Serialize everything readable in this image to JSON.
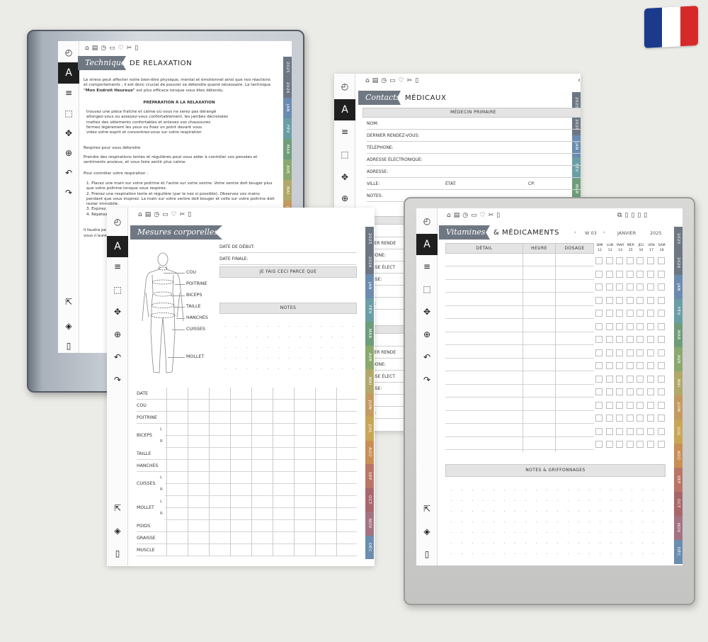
{
  "flag": {
    "colors": [
      "#1b3a8c",
      "#ffffff",
      "#d62a2a"
    ]
  },
  "toolbar_icons": [
    "timer-icon",
    "pen-icon",
    "menu-icon",
    "eraser-icon",
    "move-icon",
    "zoom-icon",
    "undo-icon",
    "redo-icon",
    "export-icon",
    "layers-icon",
    "sidebar-icon"
  ],
  "months": [
    "2025",
    "2026",
    "JAN",
    "FÉV",
    "MAR",
    "AVR",
    "MAI",
    "JUIN",
    "JUIL",
    "AOÛ",
    "SEP",
    "OCT",
    "NOV",
    "DÉC"
  ],
  "month_colors": [
    "#6d7783",
    "#6d7783",
    "#6b8bb0",
    "#6a9ea6",
    "#6f9d79",
    "#8aa96e",
    "#b1a86a",
    "#c49a61",
    "#c9a556",
    "#c98f55",
    "#b97565",
    "#a9676b",
    "#a57283",
    "#6a8db0"
  ],
  "relax": {
    "banner": "Techniques",
    "title": "DE RELAXATION",
    "intro": "Le stress peut affecter notre bien-être physique, mental et émotionnel ainsi que nos réactions et comportements ; il est donc crucial de pouvoir se détendre quand nécessaire. La technique",
    "intro_bold": "\"Mon Endroit Heureux\"",
    "intro_end": "est plus efficace lorsque vous êtes détendu.",
    "prep_title": "PRÉPARATION À LA RELAXATION",
    "bullets": [
      "trouvez une pièce fraîche et calme où vous ne serez pas dérangé",
      "allongez-vous ou asseyez-vous confortablement, les jambes décroisées",
      "mettez des vêtements confortables et enlevez vos chaussures",
      "fermez légèrement les yeux ou fixez un point devant vous",
      "videz votre esprit et concentrez-vous sur votre respiration"
    ],
    "breathe": "Respirez pour vous détendre",
    "breathe_text": "Prendre des respirations lentes et régulières peut vous aider à contrôler vos pensées et sentiments anxieux, et vous faire sentir plus calme.",
    "control": "Pour contrôler votre respiration :",
    "steps": [
      "1. Placez une main sur votre poitrine et l'autre sur votre ventre. Votre ventre doit bouger plus que votre poitrine lorsque vous respirez.",
      "2. Prenez une respiration lente et régulière (par le nez si possible). Observez vos mains pendant que vous inspirez. La main sur votre ventre doit bouger et celle sur votre poitrine doit rester immobile.",
      "3. Expirez a",
      "4. Répétez"
    ],
    "tail1": "Il faudra pe",
    "tail2": "vous n'aure"
  },
  "contacts": {
    "banner": "Contacts",
    "title": "MÉDICAUX",
    "section": "MÉDECIN PRIMAIRE",
    "fields": [
      "NOM:",
      "DERNIER RENDEZ-VOUS:",
      "TÉLÉPHONE:",
      "ADRESSE ÉLECTRONIQUE:",
      "ADRESSE:"
    ],
    "ville": "VILLE:",
    "etat": "ÉTAT:",
    "cp": "CP:",
    "notes": "NOTES:",
    "partial1": [
      "M:",
      "RNIER RENDE",
      "ÉPHONE:",
      "RESSE ÉLECT",
      "RESSE:",
      "LE:",
      "TES:"
    ],
    "partial2": [
      "M:",
      "RNIER RENDE",
      "ÉPHONE:",
      "RESSE ÉLECT",
      "RESSE:",
      "LE:",
      "TES:"
    ]
  },
  "mesures": {
    "banner": "Mesures corporelles",
    "start": "DATE DE DÉBUT:",
    "end": "DATE FINALE:",
    "reason": "JE FAIS CECI PARCE QUE",
    "notes": "NOTES",
    "body_labels": [
      "COU",
      "POITRINE",
      "BICEPS",
      "TAILLE",
      "HANCHES",
      "CUISSES",
      "MOLLET"
    ],
    "rows": [
      "DATE",
      "COU",
      "POITRINE",
      "BICEPS",
      "TAILLE",
      "HANCHES",
      "CUISSES",
      "MOLLET",
      "POIDS",
      "GRAISSE",
      "MUSCLE"
    ],
    "l": "L",
    "r": "R"
  },
  "vitamines": {
    "banner": "Vitamines",
    "title": "& MÉDICAMENTS",
    "prev": "‹",
    "week": "W 03",
    "next": "›",
    "month": "JANVIER",
    "year": "2025",
    "col_detail": "DÉTAIL",
    "col_heure": "HEURE",
    "col_dosage": "DOSAGE",
    "days": [
      "DIM",
      "LUN",
      "MAR",
      "MER",
      "JEU",
      "VEN",
      "SAM"
    ],
    "dates": [
      "12",
      "13",
      "14",
      "15",
      "16",
      "17",
      "18"
    ],
    "notes": "NOTES & GRIFFONNAGES"
  }
}
